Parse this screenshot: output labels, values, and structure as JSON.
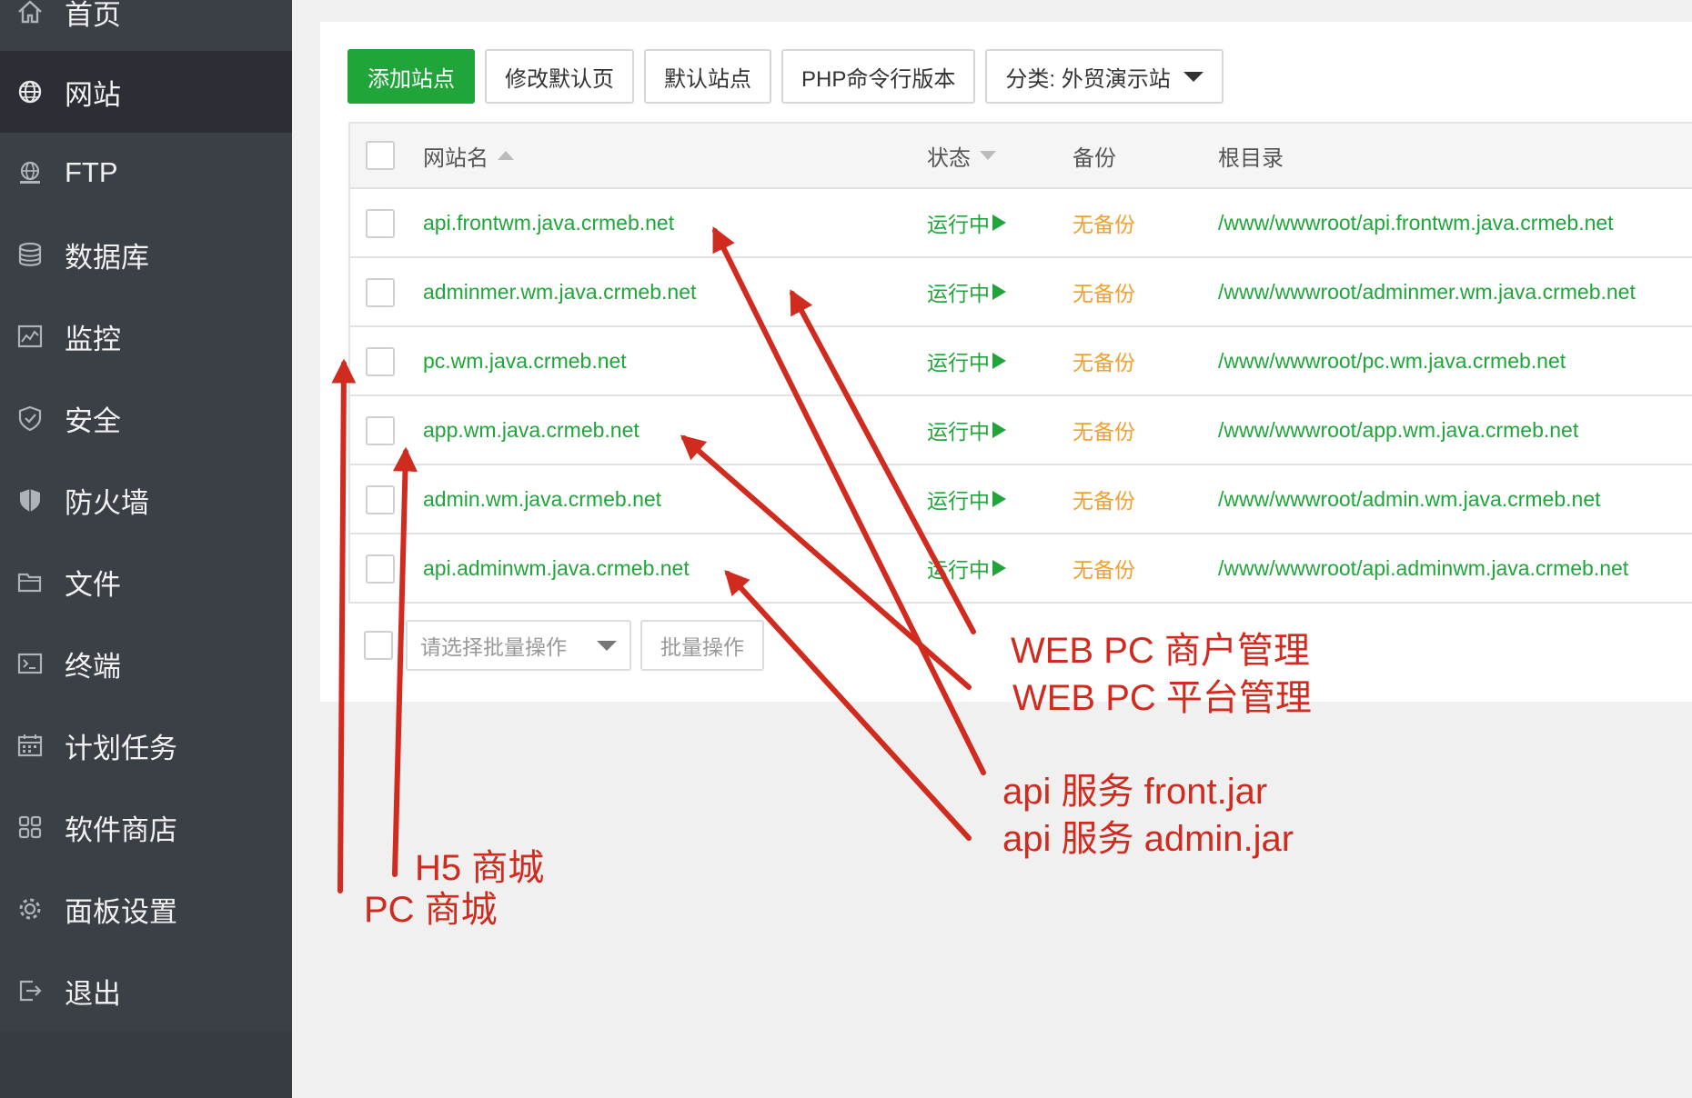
{
  "sidebar": {
    "items": [
      {
        "label": "首页",
        "icon": "home-icon"
      },
      {
        "label": "网站",
        "icon": "globe-icon",
        "active": true
      },
      {
        "label": "FTP",
        "icon": "ftp-globe-icon"
      },
      {
        "label": "数据库",
        "icon": "database-icon"
      },
      {
        "label": "监控",
        "icon": "monitor-chart-icon"
      },
      {
        "label": "安全",
        "icon": "shield-check-icon"
      },
      {
        "label": "防火墙",
        "icon": "firewall-shield-icon"
      },
      {
        "label": "文件",
        "icon": "folder-icon"
      },
      {
        "label": "终端",
        "icon": "terminal-icon"
      },
      {
        "label": "计划任务",
        "icon": "calendar-icon"
      },
      {
        "label": "软件商店",
        "icon": "apps-grid-icon"
      },
      {
        "label": "面板设置",
        "icon": "gear-icon"
      },
      {
        "label": "退出",
        "icon": "logout-icon"
      }
    ]
  },
  "toolbar": {
    "add_site": "添加站点",
    "edit_default_page": "修改默认页",
    "default_site": "默认站点",
    "php_cli_version": "PHP命令行版本",
    "category_filter": "分类: 外贸演示站"
  },
  "table": {
    "headers": {
      "name": "网站名",
      "status": "状态",
      "backup": "备份",
      "root": "根目录"
    },
    "rows": [
      {
        "name": "api.frontwm.java.crmeb.net",
        "status": "运行中",
        "backup": "无备份",
        "root": "/www/wwwroot/api.frontwm.java.crmeb.net"
      },
      {
        "name": "adminmer.wm.java.crmeb.net",
        "status": "运行中",
        "backup": "无备份",
        "root": "/www/wwwroot/adminmer.wm.java.crmeb.net"
      },
      {
        "name": "pc.wm.java.crmeb.net",
        "status": "运行中",
        "backup": "无备份",
        "root": "/www/wwwroot/pc.wm.java.crmeb.net"
      },
      {
        "name": "app.wm.java.crmeb.net",
        "status": "运行中",
        "backup": "无备份",
        "root": "/www/wwwroot/app.wm.java.crmeb.net"
      },
      {
        "name": "admin.wm.java.crmeb.net",
        "status": "运行中",
        "backup": "无备份",
        "root": "/www/wwwroot/admin.wm.java.crmeb.net"
      },
      {
        "name": "api.adminwm.java.crmeb.net",
        "status": "运行中",
        "backup": "无备份",
        "root": "/www/wwwroot/api.adminwm.java.crmeb.net"
      }
    ]
  },
  "batch": {
    "select_placeholder": "请选择批量操作",
    "button": "批量操作"
  },
  "annotations": {
    "web_pc_merchant": "WEB PC 商户管理",
    "web_pc_platform": "WEB  PC 平台管理",
    "api_front": "api  服务 front.jar",
    "api_admin": "api  服务 admin.jar",
    "h5_mall": "H5 商城",
    "pc_mall": "PC  商城"
  },
  "colors": {
    "sidebar_bg": "#3b3f46",
    "sidebar_active_bg": "#2b2f35",
    "primary_green": "#20a53a",
    "backup_orange": "#f0a02e",
    "annotation_red": "#d12b1f"
  }
}
